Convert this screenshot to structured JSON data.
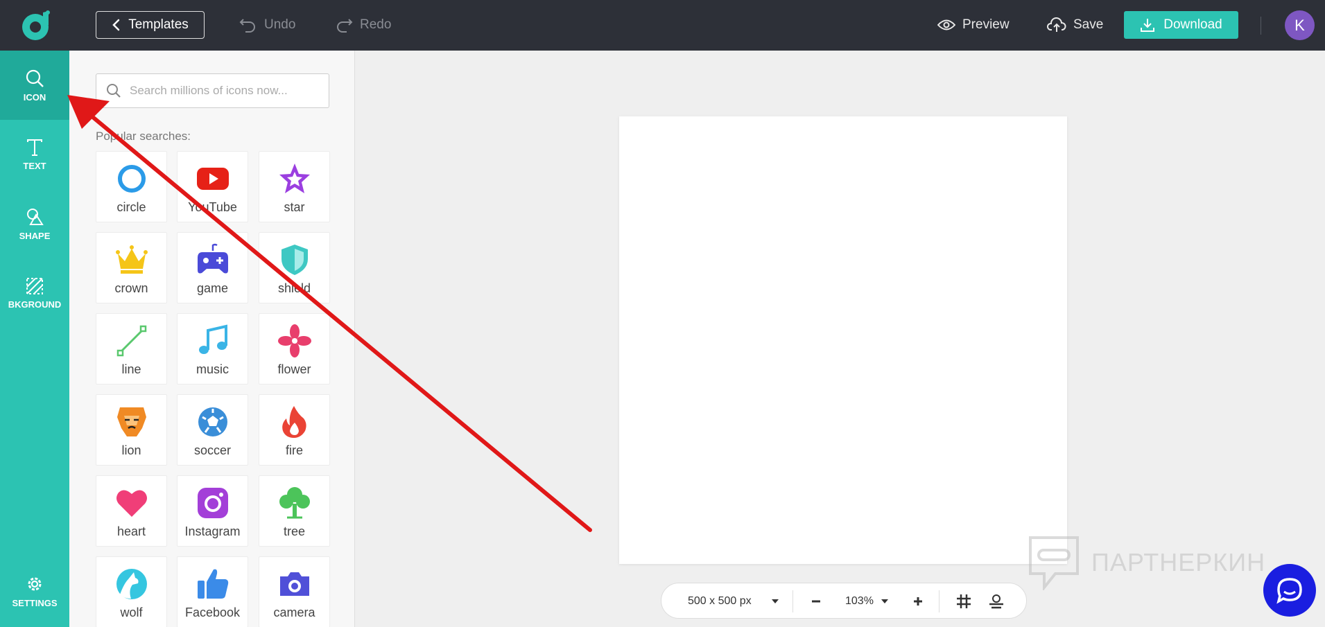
{
  "topbar": {
    "templates_label": "Templates",
    "undo_label": "Undo",
    "redo_label": "Redo",
    "preview_label": "Preview",
    "save_label": "Save",
    "download_label": "Download",
    "avatar_initial": "K",
    "accent_color": "#2cc3b2",
    "background_color": "#2d3038"
  },
  "sidebar": {
    "items": [
      {
        "label": "ICON",
        "icon": "search-icon",
        "active": true
      },
      {
        "label": "TEXT",
        "icon": "text-icon",
        "active": false
      },
      {
        "label": "SHAPE",
        "icon": "shape-icon",
        "active": false
      },
      {
        "label": "BKGROUND",
        "icon": "background-icon",
        "active": false
      }
    ],
    "settings_label": "SETTINGS"
  },
  "panel": {
    "search_placeholder": "Search millions of icons now...",
    "popular_label": "Popular searches:",
    "tiles": [
      {
        "label": "circle",
        "icon": "circle-icon",
        "color": "#2b9be8"
      },
      {
        "label": "YouTube",
        "icon": "youtube-icon",
        "color": "#e62117"
      },
      {
        "label": "star",
        "icon": "star-icon",
        "color": "#9b3fe0"
      },
      {
        "label": "crown",
        "icon": "crown-icon",
        "color": "#f5c518"
      },
      {
        "label": "game",
        "icon": "gamepad-icon",
        "color": "#4a4ad8"
      },
      {
        "label": "shield",
        "icon": "shield-icon",
        "color": "#3ec8c3"
      },
      {
        "label": "line",
        "icon": "line-icon",
        "color": "#5ac86e"
      },
      {
        "label": "music",
        "icon": "music-note-icon",
        "color": "#3ab4e6"
      },
      {
        "label": "flower",
        "icon": "flower-icon",
        "color": "#e83e6c"
      },
      {
        "label": "lion",
        "icon": "lion-icon",
        "color": "#f08a24"
      },
      {
        "label": "soccer",
        "icon": "soccer-ball-icon",
        "color": "#3a8ed8"
      },
      {
        "label": "fire",
        "icon": "fire-icon",
        "color": "#ea4335"
      },
      {
        "label": "heart",
        "icon": "heart-icon",
        "color": "#f03e78"
      },
      {
        "label": "Instagram",
        "icon": "instagram-icon",
        "color": "#a33fd8"
      },
      {
        "label": "tree",
        "icon": "tree-icon",
        "color": "#4cc45a"
      },
      {
        "label": "wolf",
        "icon": "wolf-icon",
        "color": "#35c6e0"
      },
      {
        "label": "Facebook",
        "icon": "thumbs-up-icon",
        "color": "#3b8be8"
      },
      {
        "label": "camera",
        "icon": "camera-icon",
        "color": "#5050d8"
      }
    ]
  },
  "bottombar": {
    "canvas_size": "500 x 500 px",
    "zoom": "103%"
  },
  "watermark": {
    "text": "ПАРТНЕРКИН"
  }
}
